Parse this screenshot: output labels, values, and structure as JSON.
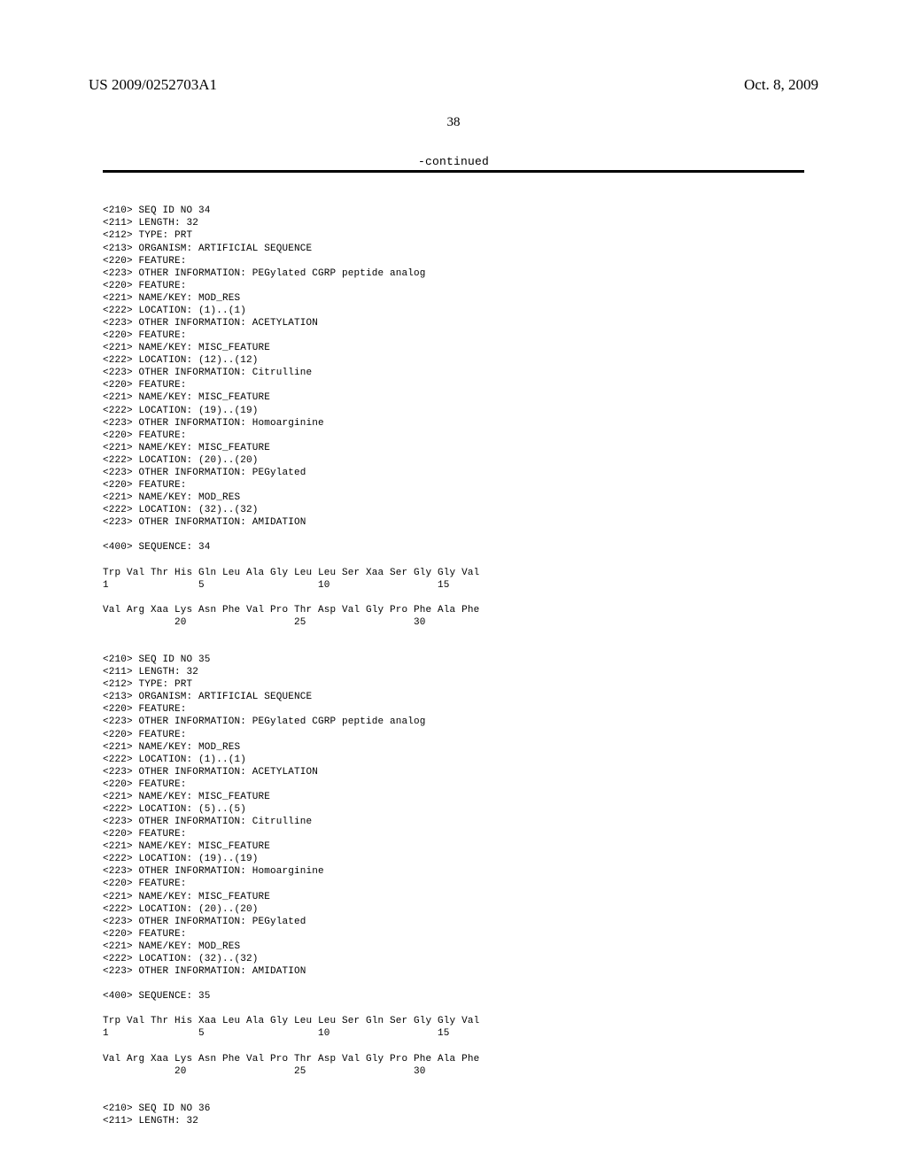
{
  "header": {
    "pub_number": "US 2009/0252703A1",
    "pub_date": "Oct. 8, 2009",
    "page_number": "38",
    "continued": "-continued"
  },
  "sequence_text": "\n<210> SEQ ID NO 34\n<211> LENGTH: 32\n<212> TYPE: PRT\n<213> ORGANISM: ARTIFICIAL SEQUENCE\n<220> FEATURE:\n<223> OTHER INFORMATION: PEGylated CGRP peptide analog\n<220> FEATURE:\n<221> NAME/KEY: MOD_RES\n<222> LOCATION: (1)..(1)\n<223> OTHER INFORMATION: ACETYLATION\n<220> FEATURE:\n<221> NAME/KEY: MISC_FEATURE\n<222> LOCATION: (12)..(12)\n<223> OTHER INFORMATION: Citrulline\n<220> FEATURE:\n<221> NAME/KEY: MISC_FEATURE\n<222> LOCATION: (19)..(19)\n<223> OTHER INFORMATION: Homoarginine\n<220> FEATURE:\n<221> NAME/KEY: MISC_FEATURE\n<222> LOCATION: (20)..(20)\n<223> OTHER INFORMATION: PEGylated\n<220> FEATURE:\n<221> NAME/KEY: MOD_RES\n<222> LOCATION: (32)..(32)\n<223> OTHER INFORMATION: AMIDATION\n\n<400> SEQUENCE: 34\n\nTrp Val Thr His Gln Leu Ala Gly Leu Leu Ser Xaa Ser Gly Gly Val\n1               5                   10                  15\n\nVal Arg Xaa Lys Asn Phe Val Pro Thr Asp Val Gly Pro Phe Ala Phe\n            20                  25                  30\n\n\n<210> SEQ ID NO 35\n<211> LENGTH: 32\n<212> TYPE: PRT\n<213> ORGANISM: ARTIFICIAL SEQUENCE\n<220> FEATURE:\n<223> OTHER INFORMATION: PEGylated CGRP peptide analog\n<220> FEATURE:\n<221> NAME/KEY: MOD_RES\n<222> LOCATION: (1)..(1)\n<223> OTHER INFORMATION: ACETYLATION\n<220> FEATURE:\n<221> NAME/KEY: MISC_FEATURE\n<222> LOCATION: (5)..(5)\n<223> OTHER INFORMATION: Citrulline\n<220> FEATURE:\n<221> NAME/KEY: MISC_FEATURE\n<222> LOCATION: (19)..(19)\n<223> OTHER INFORMATION: Homoarginine\n<220> FEATURE:\n<221> NAME/KEY: MISC_FEATURE\n<222> LOCATION: (20)..(20)\n<223> OTHER INFORMATION: PEGylated\n<220> FEATURE:\n<221> NAME/KEY: MOD_RES\n<222> LOCATION: (32)..(32)\n<223> OTHER INFORMATION: AMIDATION\n\n<400> SEQUENCE: 35\n\nTrp Val Thr His Xaa Leu Ala Gly Leu Leu Ser Gln Ser Gly Gly Val\n1               5                   10                  15\n\nVal Arg Xaa Lys Asn Phe Val Pro Thr Asp Val Gly Pro Phe Ala Phe\n            20                  25                  30\n\n\n<210> SEQ ID NO 36\n<211> LENGTH: 32"
}
